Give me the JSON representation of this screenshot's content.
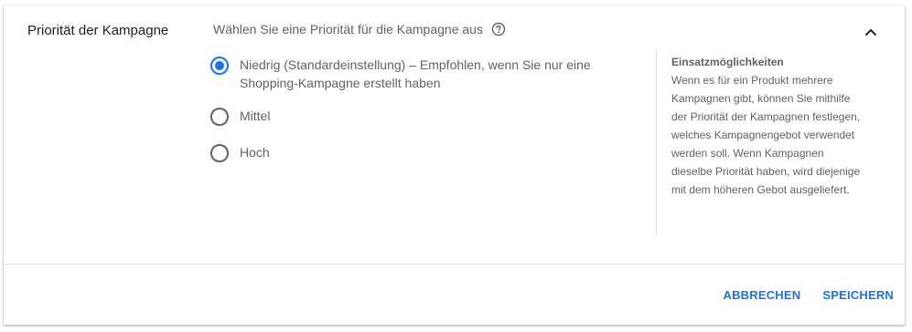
{
  "section": {
    "title": "Priorität der Kampagne",
    "prompt": "Wählen Sie eine Priorität für die Kampagne aus"
  },
  "options": [
    {
      "label": "Niedrig (Standardeinstellung) – Empfohlen, wenn Sie nur eine Shopping-Kampagne erstellt haben",
      "selected": true
    },
    {
      "label": "Mittel",
      "selected": false
    },
    {
      "label": "Hoch",
      "selected": false
    }
  ],
  "info": {
    "title": "Einsatzmöglichkeiten",
    "body": "Wenn es für ein Produkt mehrere Kampagnen gibt, können Sie mithilfe der Priorität der Kampagnen festlegen, welches Kampagnengebot verwendet werden soll. Wenn Kampagnen dieselbe Priorität haben, wird diejenige mit dem höheren Gebot ausgeliefert."
  },
  "actions": {
    "cancel_label": "ABBRECHEN",
    "save_label": "SPEICHERN"
  },
  "icons": {
    "help": "help-circle-icon",
    "collapse": "chevron-up-icon"
  },
  "colors": {
    "accent": "#1a73e8",
    "text_primary": "#202124",
    "text_secondary": "#5f6368",
    "divider": "#e0e0e0"
  }
}
